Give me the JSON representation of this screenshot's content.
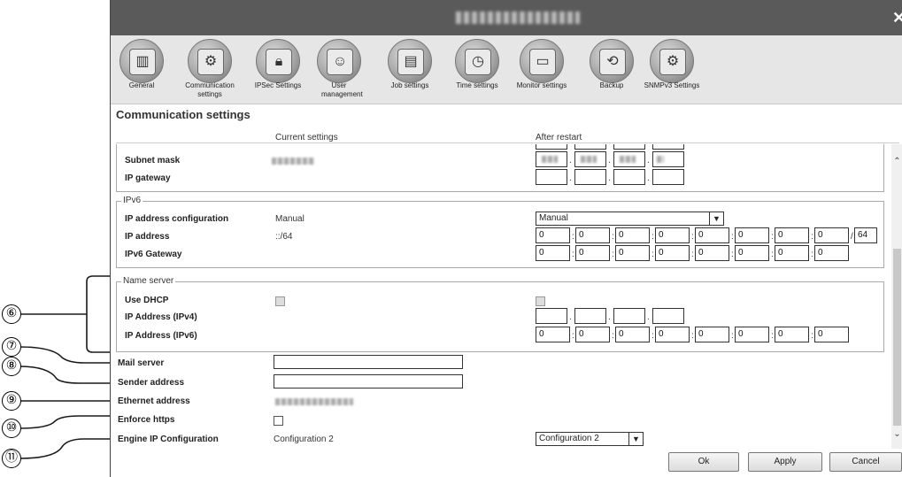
{
  "toolbar": {
    "items": [
      {
        "label": "General",
        "icon": "server-icon"
      },
      {
        "label": "Communication settings",
        "icon": "network-icon"
      },
      {
        "label": "IPSec Settings",
        "icon": "lock-network-icon"
      },
      {
        "label": "User management",
        "icon": "users-icon"
      },
      {
        "label": "Job settings",
        "icon": "document-icon"
      },
      {
        "label": "Time settings",
        "icon": "clock-icon"
      },
      {
        "label": "Monitor settings",
        "icon": "monitor-icon"
      },
      {
        "label": "Backup",
        "icon": "backup-icon"
      },
      {
        "label": "SNMPv3 Settings",
        "icon": "snmp-icon"
      }
    ]
  },
  "page": {
    "title": "Communication settings",
    "col_current": "Current settings",
    "col_after": "After restart"
  },
  "ipv4": {
    "subnet_mask_label": "Subnet mask",
    "ip_gateway_label": "IP gateway"
  },
  "ipv6": {
    "legend": "IPv6",
    "config_label": "IP address configuration",
    "config_current": "Manual",
    "config_after": "Manual",
    "address_label": "IP address",
    "address_current": "::/64",
    "address_after": [
      "0",
      "0",
      "0",
      "0",
      "0",
      "0",
      "0",
      "0"
    ],
    "prefix_after": "64",
    "gateway_label": "IPv6 Gateway",
    "gateway_after": [
      "0",
      "0",
      "0",
      "0",
      "0",
      "0",
      "0",
      "0"
    ]
  },
  "name_server": {
    "legend": "Name server",
    "dhcp_label": "Use DHCP",
    "ipv4_label": "IP Address (IPv4)",
    "ipv6_label": "IP Address (IPv6)",
    "ipv6_after": [
      "0",
      "0",
      "0",
      "0",
      "0",
      "0",
      "0",
      "0"
    ]
  },
  "other": {
    "mail_server_label": "Mail server",
    "sender_address_label": "Sender address",
    "ethernet_label": "Ethernet address",
    "https_label": "Enforce https",
    "engine_label": "Engine IP Configuration",
    "engine_current": "Configuration 2",
    "engine_after": "Configuration 2"
  },
  "buttons": {
    "ok": "Ok",
    "apply": "Apply",
    "cancel": "Cancel"
  },
  "callouts": [
    "⑥",
    "⑦",
    "⑧",
    "⑨",
    "⑩",
    "⑪"
  ]
}
